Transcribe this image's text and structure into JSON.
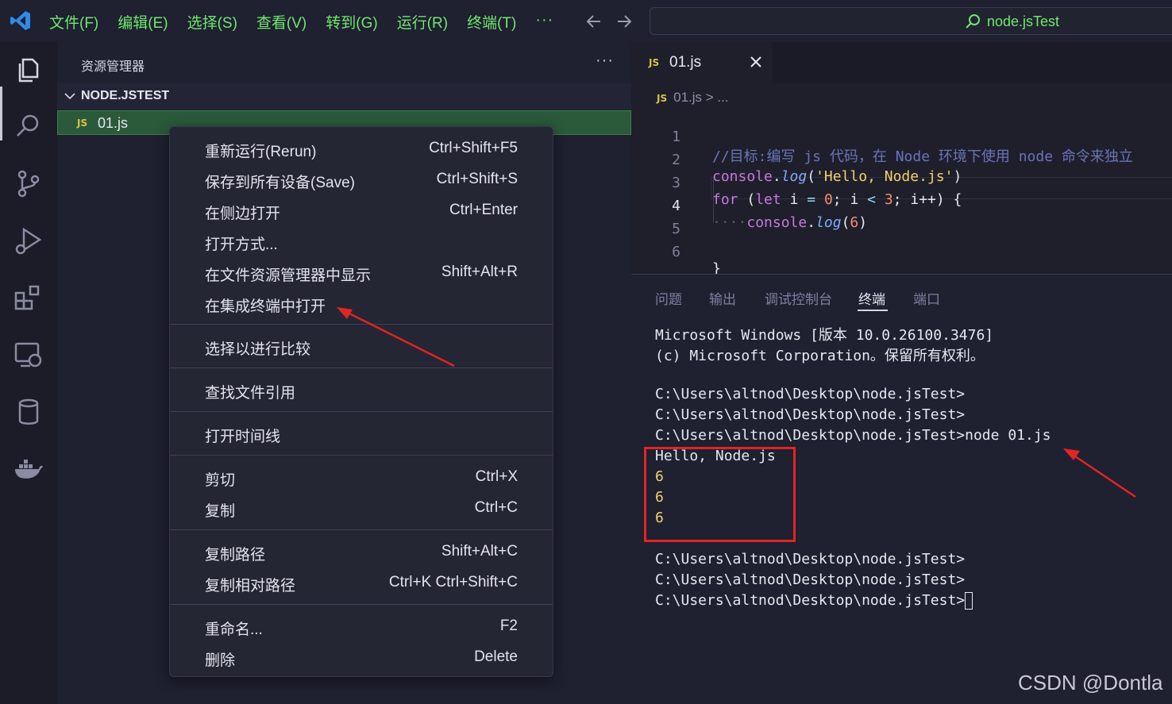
{
  "titlebar": {
    "menu": [
      "文件(F)",
      "编辑(E)",
      "选择(S)",
      "查看(V)",
      "转到(G)",
      "运行(R)",
      "终端(T)"
    ],
    "more": "···",
    "search_title": "node.jsTest"
  },
  "sidebar": {
    "title": "资源管理器",
    "more": "···",
    "folder": "NODE.JSTEST",
    "file": {
      "badge": "JS",
      "name": "01.js"
    }
  },
  "context_menu": {
    "items": [
      {
        "label": "重新运行(Rerun)",
        "shortcut": "Ctrl+Shift+F5"
      },
      {
        "label": "保存到所有设备(Save)",
        "shortcut": "Ctrl+Shift+S"
      },
      {
        "label": "在侧边打开",
        "shortcut": "Ctrl+Enter"
      },
      {
        "label": "打开方式...",
        "shortcut": ""
      },
      {
        "label": "在文件资源管理器中显示",
        "shortcut": "Shift+Alt+R"
      },
      {
        "label": "在集成终端中打开",
        "shortcut": ""
      },
      {
        "label": "选择以进行比较",
        "shortcut": ""
      },
      {
        "label": "查找文件引用",
        "shortcut": ""
      },
      {
        "label": "打开时间线",
        "shortcut": ""
      },
      {
        "label": "剪切",
        "shortcut": "Ctrl+X"
      },
      {
        "label": "复制",
        "shortcut": "Ctrl+C"
      },
      {
        "label": "复制路径",
        "shortcut": "Shift+Alt+C"
      },
      {
        "label": "复制相对路径",
        "shortcut": "Ctrl+K Ctrl+Shift+C"
      },
      {
        "label": "重命名...",
        "shortcut": "F2"
      },
      {
        "label": "删除",
        "shortcut": "Delete"
      }
    ]
  },
  "editor": {
    "tab": {
      "badge": "JS",
      "name": "01.js"
    },
    "breadcrumb": {
      "badge": "JS",
      "text": "01.js > ..."
    },
    "line_numbers": [
      "1",
      "2",
      "3",
      "4",
      "5",
      "6"
    ],
    "code": {
      "l1": "//目标:编写 js 代码，在 Node 环境下使用 node 命令来独立",
      "l2_obj": "console",
      "l2_fn": "log",
      "l2_str": "'Hello, Node.js'",
      "l3_for": "for",
      "l3_let": "let",
      "l3_i": "i",
      "l3_eq": "=",
      "l3_zero": "0",
      "l3_lt": "<",
      "l3_three": "3",
      "l3_inc": "i++",
      "l4_obj": "console",
      "l4_fn": "log",
      "l4_num": "6",
      "l6": "}"
    }
  },
  "panel": {
    "tabs": [
      "问题",
      "输出",
      "调试控制台",
      "终端",
      "端口"
    ],
    "active_tab": "终端",
    "terminal": {
      "header1": "Microsoft Windows [版本 10.0.26100.3476]",
      "header2": "(c) Microsoft Corporation。保留所有权利。",
      "prompt1": "C:\\Users\\altnod\\Desktop\\node.jsTest>",
      "prompt2": "C:\\Users\\altnod\\Desktop\\node.jsTest>",
      "cmd": "C:\\Users\\altnod\\Desktop\\node.jsTest>node 01.js",
      "out1": "Hello, Node.js",
      "out2": "6",
      "out3": "6",
      "out4": "6",
      "prompt3": "C:\\Users\\altnod\\Desktop\\node.jsTest>",
      "prompt4": "C:\\Users\\altnod\\Desktop\\node.jsTest>",
      "prompt5": "C:\\Users\\altnod\\Desktop\\node.jsTest>"
    }
  },
  "watermark": "CSDN @Dontla",
  "colors": {
    "menu_text": "#6ee86e",
    "annotation_red": "#e02525",
    "selected_file": "#2a5a3a"
  }
}
